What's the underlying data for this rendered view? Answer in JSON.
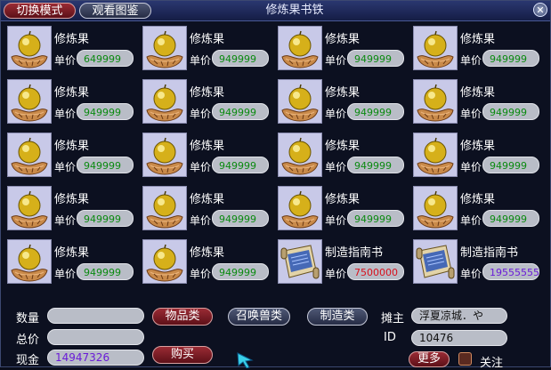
{
  "window": {
    "title": "修炼果书铁",
    "mode_button": "切换模式",
    "gallery_button": "观看图鉴",
    "close_icon": "close-icon"
  },
  "items": [
    {
      "name": "修炼果",
      "price_label": "单价",
      "price": "649999",
      "icon": "golden-fruit-icon",
      "price_color": "green"
    },
    {
      "name": "修炼果",
      "price_label": "单价",
      "price": "949999",
      "icon": "golden-fruit-icon",
      "price_color": "green"
    },
    {
      "name": "修炼果",
      "price_label": "单价",
      "price": "949999",
      "icon": "golden-fruit-icon",
      "price_color": "green"
    },
    {
      "name": "修炼果",
      "price_label": "单价",
      "price": "949999",
      "icon": "golden-fruit-icon",
      "price_color": "green"
    },
    {
      "name": "修炼果",
      "price_label": "单价",
      "price": "949999",
      "icon": "golden-fruit-icon",
      "price_color": "green"
    },
    {
      "name": "修炼果",
      "price_label": "单价",
      "price": "949999",
      "icon": "golden-fruit-icon",
      "price_color": "green"
    },
    {
      "name": "修炼果",
      "price_label": "单价",
      "price": "949999",
      "icon": "golden-fruit-icon",
      "price_color": "green"
    },
    {
      "name": "修炼果",
      "price_label": "单价",
      "price": "949999",
      "icon": "golden-fruit-icon",
      "price_color": "green"
    },
    {
      "name": "修炼果",
      "price_label": "单价",
      "price": "949999",
      "icon": "golden-fruit-icon",
      "price_color": "green"
    },
    {
      "name": "修炼果",
      "price_label": "单价",
      "price": "949999",
      "icon": "golden-fruit-icon",
      "price_color": "green"
    },
    {
      "name": "修炼果",
      "price_label": "单价",
      "price": "949999",
      "icon": "golden-fruit-icon",
      "price_color": "green"
    },
    {
      "name": "修炼果",
      "price_label": "单价",
      "price": "949999",
      "icon": "golden-fruit-icon",
      "price_color": "green"
    },
    {
      "name": "修炼果",
      "price_label": "单价",
      "price": "949999",
      "icon": "golden-fruit-icon",
      "price_color": "green"
    },
    {
      "name": "修炼果",
      "price_label": "单价",
      "price": "949999",
      "icon": "golden-fruit-icon",
      "price_color": "green"
    },
    {
      "name": "修炼果",
      "price_label": "单价",
      "price": "949999",
      "icon": "golden-fruit-icon",
      "price_color": "green"
    },
    {
      "name": "修炼果",
      "price_label": "单价",
      "price": "949999",
      "icon": "golden-fruit-icon",
      "price_color": "green"
    },
    {
      "name": "修炼果",
      "price_label": "单价",
      "price": "949999",
      "icon": "golden-fruit-icon",
      "price_color": "green"
    },
    {
      "name": "修炼果",
      "price_label": "单价",
      "price": "949999",
      "icon": "golden-fruit-icon",
      "price_color": "green"
    },
    {
      "name": "制造指南书",
      "price_label": "单价",
      "price": "7500000",
      "icon": "scroll-book-icon",
      "price_color": "red"
    },
    {
      "name": "制造指南书",
      "price_label": "单价",
      "price": "19555555",
      "icon": "scroll-book-icon",
      "price_color": "purple"
    }
  ],
  "footer": {
    "quantity_label": "数量",
    "quantity_value": "",
    "total_label": "总价",
    "total_value": "",
    "cash_label": "现金",
    "cash_value": "14947326",
    "category_items": "物品类",
    "category_pets": "召唤兽类",
    "category_craft": "制造类",
    "buy_button": "购买",
    "owner_label": "摊主",
    "owner_value": "浮夏凉城．や",
    "id_label": "ID",
    "id_value": "10476",
    "more_button": "更多",
    "follow_label": "关注"
  },
  "colors": {
    "price_green": "#0a8a10",
    "price_red": "#d8101c",
    "price_purple": "#6a1bd8",
    "cash_purple": "#6a1bd8"
  }
}
